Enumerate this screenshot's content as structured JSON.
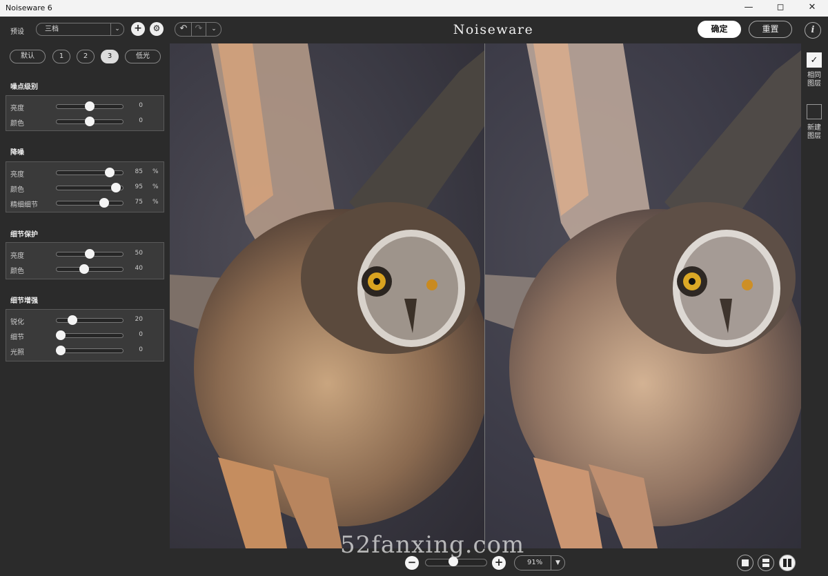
{
  "window": {
    "title": "Noiseware 6",
    "minimize_icon": "minimize-icon",
    "maximize_icon": "maximize-icon",
    "close_icon": "close-icon"
  },
  "toolbar": {
    "preset_label": "预设",
    "preset_value": "三档",
    "add_icon": "plus-icon",
    "settings_icon": "gear-icon",
    "logo": "Noiseware",
    "ok_label": "确定",
    "reset_label": "重置",
    "info_label": "i"
  },
  "presets": [
    "默认",
    "1",
    "2",
    "3",
    "低光"
  ],
  "active_preset": "3",
  "sections": {
    "noise_level": {
      "title": "噪点级别",
      "rows": [
        {
          "label": "亮度",
          "value": "0",
          "unit": "",
          "level": 0.5
        },
        {
          "label": "颜色",
          "value": "0",
          "unit": "",
          "level": 0.5
        }
      ]
    },
    "denoise": {
      "title": "降噪",
      "rows": [
        {
          "label": "亮度",
          "value": "85",
          "unit": "%",
          "level": 0.85
        },
        {
          "label": "颜色",
          "value": "95",
          "unit": "%",
          "level": 0.95
        },
        {
          "label": "精细细节",
          "value": "75",
          "unit": "%",
          "level": 0.75
        }
      ]
    },
    "detail_protect": {
      "title": "细节保护",
      "rows": [
        {
          "label": "亮度",
          "value": "50",
          "unit": "",
          "level": 0.5
        },
        {
          "label": "颜色",
          "value": "40",
          "unit": "",
          "level": 0.4
        }
      ]
    },
    "detail_enhance": {
      "title": "细节增强",
      "rows": [
        {
          "label": "锐化",
          "value": "20",
          "unit": "",
          "level": 0.2
        },
        {
          "label": "细节",
          "value": "0",
          "unit": "",
          "level": 0
        },
        {
          "label": "光照",
          "value": "0",
          "unit": "",
          "level": 0
        }
      ]
    }
  },
  "side": {
    "same_layer": {
      "label_1": "相同",
      "label_2": "图层",
      "checked": true
    },
    "new_layer": {
      "label_1": "新建",
      "label_2": "图层",
      "checked": false
    }
  },
  "bottom": {
    "zoom_value": "91%",
    "zoom_level": 0.45,
    "watermark": "52fanxing.com"
  },
  "colors": {
    "background": "#2b2b2b",
    "panel": "#3a3a3a",
    "accent": "#f4f4f4"
  }
}
